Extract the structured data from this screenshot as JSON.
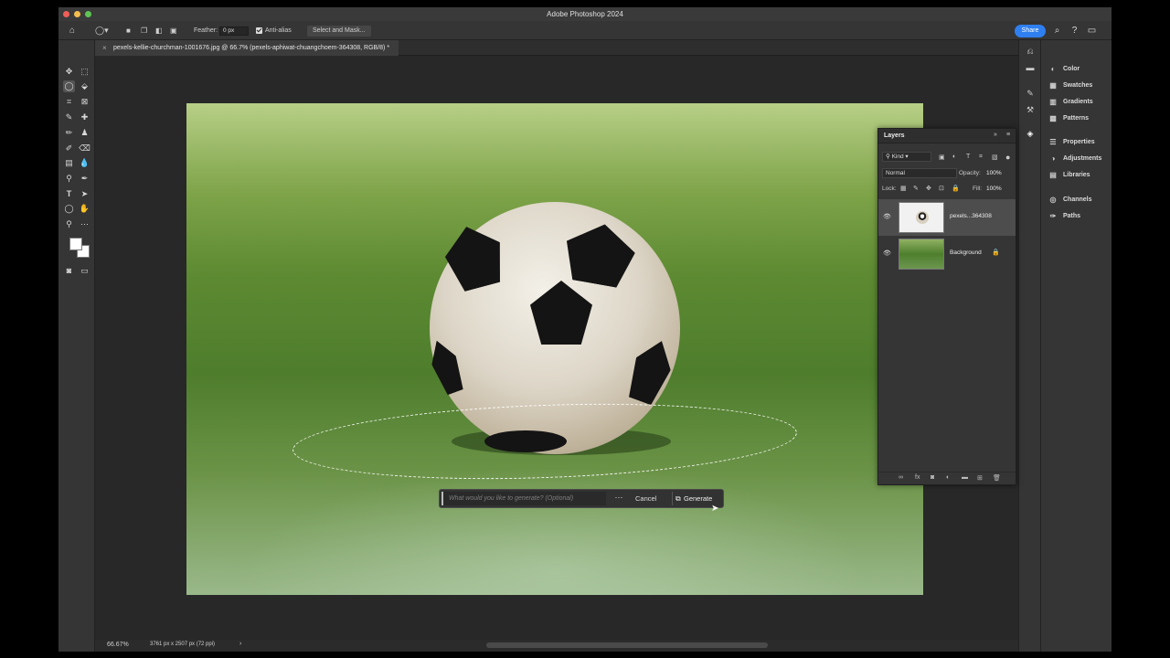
{
  "window": {
    "title": "Adobe Photoshop 2024"
  },
  "options_bar": {
    "feather_label": "Feather:",
    "feather_value": "0 px",
    "anti_alias_label": "Anti-alias",
    "select_mask_label": "Select and Mask...",
    "share_label": "Share"
  },
  "document": {
    "tab_title": "pexels-kellie-churchman-1001676.jpg @ 66.7% (pexels-aphiwat-chuangchoem-364308, RGB/8) *",
    "zoom": "66.67%",
    "dimensions": "3761 px x 2507 px (72 ppi)"
  },
  "generate_bar": {
    "placeholder": "What would you like to generate? (Optional)",
    "more": "···",
    "cancel": "Cancel",
    "generate": "Generate"
  },
  "right_panels": [
    {
      "label": "Color",
      "icon": "color-icon"
    },
    {
      "label": "Swatches",
      "icon": "swatches-icon"
    },
    {
      "label": "Gradients",
      "icon": "gradients-icon"
    },
    {
      "label": "Patterns",
      "icon": "patterns-icon"
    },
    {
      "label": "Properties",
      "icon": "properties-icon"
    },
    {
      "label": "Adjustments",
      "icon": "adjustments-icon"
    },
    {
      "label": "Libraries",
      "icon": "libraries-icon"
    },
    {
      "label": "Channels",
      "icon": "channels-icon"
    },
    {
      "label": "Paths",
      "icon": "paths-icon"
    }
  ],
  "layers_panel": {
    "title": "Layers",
    "kind_label": "Kind",
    "blend_mode": "Normal",
    "opacity_label": "Opacity:",
    "opacity_value": "100%",
    "lock_label": "Lock:",
    "fill_label": "Fill:",
    "fill_value": "100%",
    "layers": [
      {
        "name": "pexels...364308",
        "selected": true
      },
      {
        "name": "Background",
        "selected": false,
        "locked": true
      }
    ]
  },
  "colors": {
    "accent": "#2f7ff0",
    "panel": "#353535",
    "canvas": "#282828"
  }
}
